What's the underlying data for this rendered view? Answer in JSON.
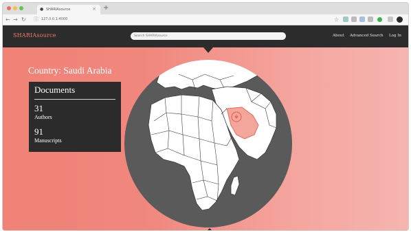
{
  "browser": {
    "tab_title": "SHARIAsource",
    "url": "127.0.0.1:4000",
    "traffic_colors": [
      "#ec6a5e",
      "#f4bf4f",
      "#61c554"
    ]
  },
  "site": {
    "brand": "SHARIAsource",
    "search_placeholder": "Search SHARIAsource",
    "nav": {
      "about": "About",
      "advanced_search": "Advanced Search",
      "login": "Log In"
    },
    "country_label": "Country: Saudi Arabia",
    "panel": {
      "title": "Documents",
      "stats": [
        {
          "number": "31",
          "label": "Authors"
        },
        {
          "number": "91",
          "label": "Manuscripts"
        }
      ]
    },
    "colors": {
      "accent": "#f1796a",
      "nav_bg": "#2c2c2c",
      "ocean": "#5a5a5a",
      "land": "#ffffff",
      "selected_country": "#f3a79c"
    }
  }
}
